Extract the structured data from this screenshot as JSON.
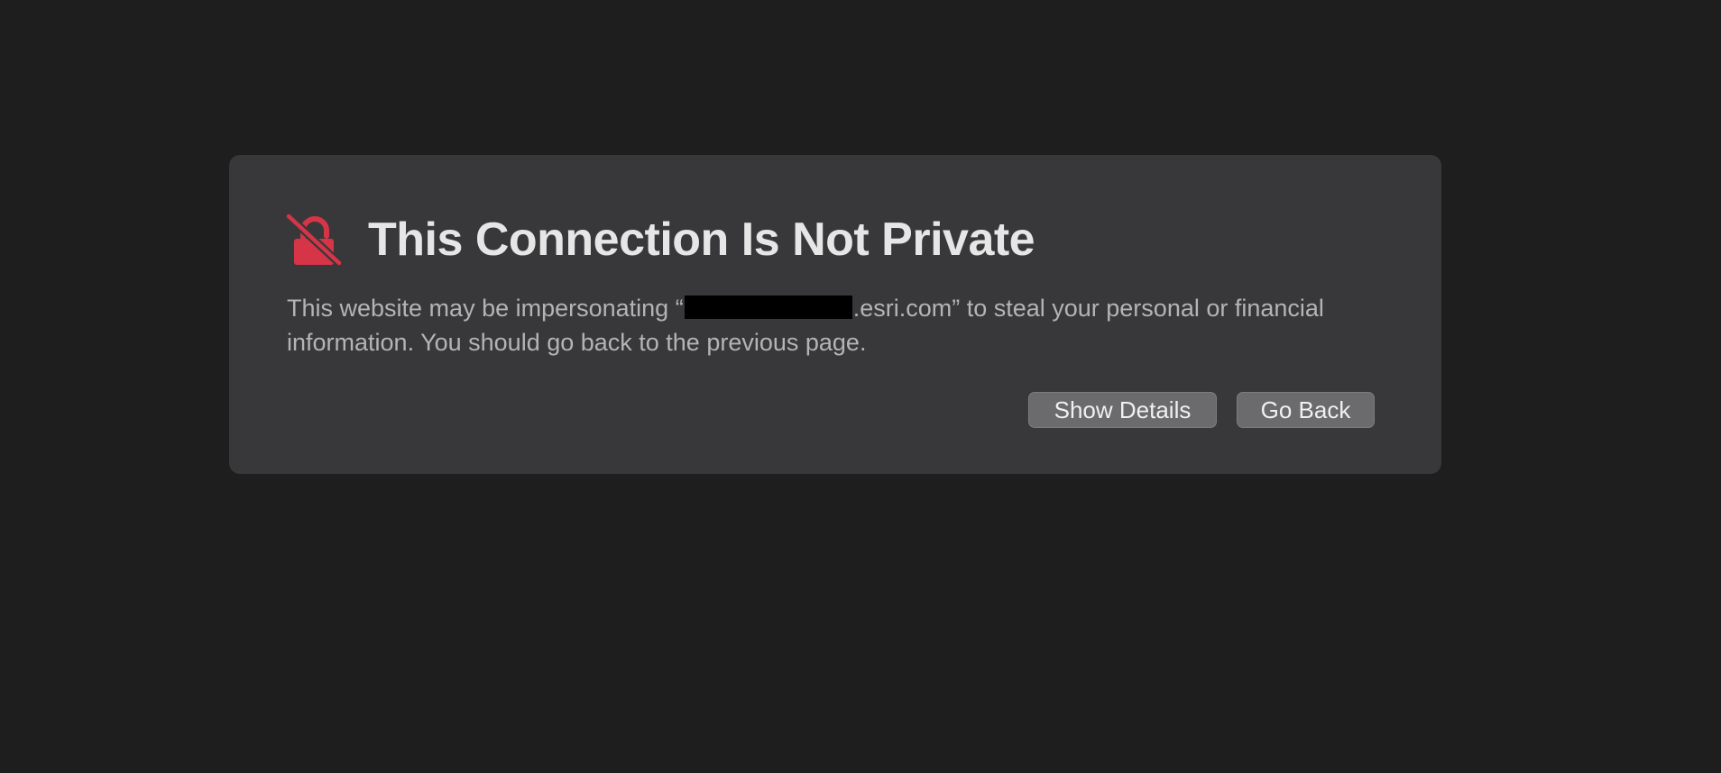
{
  "warning": {
    "icon": "unlocked-lock-slash-icon",
    "accent_color": "#d63447",
    "title": "This Connection Is Not Private",
    "message_before": "This website may be impersonating “",
    "message_after": ".esri.com” to steal your personal or financial information. You should go back to the previous page."
  },
  "buttons": {
    "show_details": "Show Details",
    "go_back": "Go Back"
  }
}
